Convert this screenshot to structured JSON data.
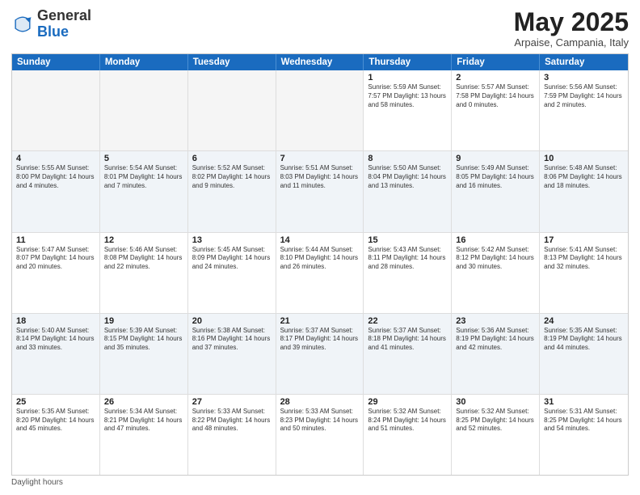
{
  "logo": {
    "general": "General",
    "blue": "Blue"
  },
  "title": "May 2025",
  "location": "Arpaise, Campania, Italy",
  "header_days": [
    "Sunday",
    "Monday",
    "Tuesday",
    "Wednesday",
    "Thursday",
    "Friday",
    "Saturday"
  ],
  "footer": "Daylight hours",
  "weeks": [
    [
      {
        "day": "",
        "info": ""
      },
      {
        "day": "",
        "info": ""
      },
      {
        "day": "",
        "info": ""
      },
      {
        "day": "",
        "info": ""
      },
      {
        "day": "1",
        "info": "Sunrise: 5:59 AM\nSunset: 7:57 PM\nDaylight: 13 hours\nand 58 minutes."
      },
      {
        "day": "2",
        "info": "Sunrise: 5:57 AM\nSunset: 7:58 PM\nDaylight: 14 hours\nand 0 minutes."
      },
      {
        "day": "3",
        "info": "Sunrise: 5:56 AM\nSunset: 7:59 PM\nDaylight: 14 hours\nand 2 minutes."
      }
    ],
    [
      {
        "day": "4",
        "info": "Sunrise: 5:55 AM\nSunset: 8:00 PM\nDaylight: 14 hours\nand 4 minutes."
      },
      {
        "day": "5",
        "info": "Sunrise: 5:54 AM\nSunset: 8:01 PM\nDaylight: 14 hours\nand 7 minutes."
      },
      {
        "day": "6",
        "info": "Sunrise: 5:52 AM\nSunset: 8:02 PM\nDaylight: 14 hours\nand 9 minutes."
      },
      {
        "day": "7",
        "info": "Sunrise: 5:51 AM\nSunset: 8:03 PM\nDaylight: 14 hours\nand 11 minutes."
      },
      {
        "day": "8",
        "info": "Sunrise: 5:50 AM\nSunset: 8:04 PM\nDaylight: 14 hours\nand 13 minutes."
      },
      {
        "day": "9",
        "info": "Sunrise: 5:49 AM\nSunset: 8:05 PM\nDaylight: 14 hours\nand 16 minutes."
      },
      {
        "day": "10",
        "info": "Sunrise: 5:48 AM\nSunset: 8:06 PM\nDaylight: 14 hours\nand 18 minutes."
      }
    ],
    [
      {
        "day": "11",
        "info": "Sunrise: 5:47 AM\nSunset: 8:07 PM\nDaylight: 14 hours\nand 20 minutes."
      },
      {
        "day": "12",
        "info": "Sunrise: 5:46 AM\nSunset: 8:08 PM\nDaylight: 14 hours\nand 22 minutes."
      },
      {
        "day": "13",
        "info": "Sunrise: 5:45 AM\nSunset: 8:09 PM\nDaylight: 14 hours\nand 24 minutes."
      },
      {
        "day": "14",
        "info": "Sunrise: 5:44 AM\nSunset: 8:10 PM\nDaylight: 14 hours\nand 26 minutes."
      },
      {
        "day": "15",
        "info": "Sunrise: 5:43 AM\nSunset: 8:11 PM\nDaylight: 14 hours\nand 28 minutes."
      },
      {
        "day": "16",
        "info": "Sunrise: 5:42 AM\nSunset: 8:12 PM\nDaylight: 14 hours\nand 30 minutes."
      },
      {
        "day": "17",
        "info": "Sunrise: 5:41 AM\nSunset: 8:13 PM\nDaylight: 14 hours\nand 32 minutes."
      }
    ],
    [
      {
        "day": "18",
        "info": "Sunrise: 5:40 AM\nSunset: 8:14 PM\nDaylight: 14 hours\nand 33 minutes."
      },
      {
        "day": "19",
        "info": "Sunrise: 5:39 AM\nSunset: 8:15 PM\nDaylight: 14 hours\nand 35 minutes."
      },
      {
        "day": "20",
        "info": "Sunrise: 5:38 AM\nSunset: 8:16 PM\nDaylight: 14 hours\nand 37 minutes."
      },
      {
        "day": "21",
        "info": "Sunrise: 5:37 AM\nSunset: 8:17 PM\nDaylight: 14 hours\nand 39 minutes."
      },
      {
        "day": "22",
        "info": "Sunrise: 5:37 AM\nSunset: 8:18 PM\nDaylight: 14 hours\nand 41 minutes."
      },
      {
        "day": "23",
        "info": "Sunrise: 5:36 AM\nSunset: 8:19 PM\nDaylight: 14 hours\nand 42 minutes."
      },
      {
        "day": "24",
        "info": "Sunrise: 5:35 AM\nSunset: 8:19 PM\nDaylight: 14 hours\nand 44 minutes."
      }
    ],
    [
      {
        "day": "25",
        "info": "Sunrise: 5:35 AM\nSunset: 8:20 PM\nDaylight: 14 hours\nand 45 minutes."
      },
      {
        "day": "26",
        "info": "Sunrise: 5:34 AM\nSunset: 8:21 PM\nDaylight: 14 hours\nand 47 minutes."
      },
      {
        "day": "27",
        "info": "Sunrise: 5:33 AM\nSunset: 8:22 PM\nDaylight: 14 hours\nand 48 minutes."
      },
      {
        "day": "28",
        "info": "Sunrise: 5:33 AM\nSunset: 8:23 PM\nDaylight: 14 hours\nand 50 minutes."
      },
      {
        "day": "29",
        "info": "Sunrise: 5:32 AM\nSunset: 8:24 PM\nDaylight: 14 hours\nand 51 minutes."
      },
      {
        "day": "30",
        "info": "Sunrise: 5:32 AM\nSunset: 8:25 PM\nDaylight: 14 hours\nand 52 minutes."
      },
      {
        "day": "31",
        "info": "Sunrise: 5:31 AM\nSunset: 8:25 PM\nDaylight: 14 hours\nand 54 minutes."
      }
    ]
  ]
}
